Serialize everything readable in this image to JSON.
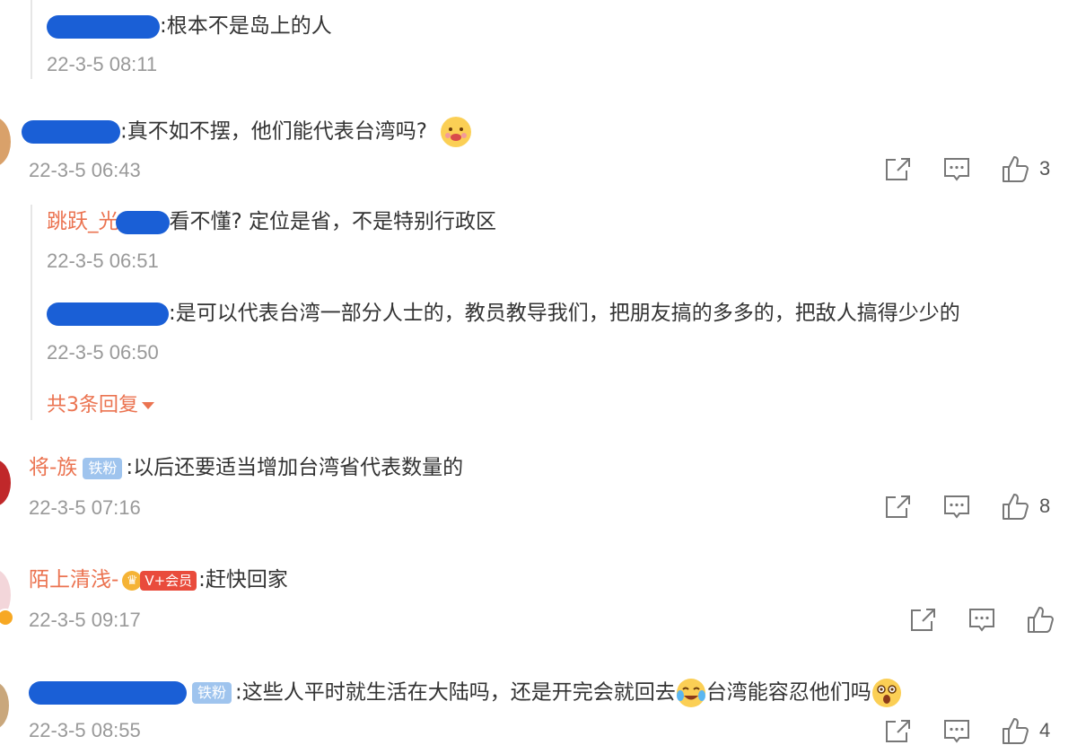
{
  "comments": [
    {
      "replies": [
        {
          "text": ":根本不是岛上的人",
          "time": "22-3-5 08:11"
        }
      ]
    },
    {
      "text": ":真不如不摆，他们能代表台湾吗?",
      "time": "22-3-5 06:43",
      "like_count": "3",
      "replies": [
        {
          "author_partial": "跳跃_光",
          "text": "看不懂? 定位是省，不是特别行政区",
          "time": "22-3-5 06:51"
        },
        {
          "text": ":是可以代表台湾一部分人士的，教员教导我们，把朋友搞的多多的，把敌人搞得少少的",
          "time": "22-3-5 06:50"
        }
      ],
      "more_replies": "共3条回复"
    },
    {
      "author": "将-族",
      "badge": "铁粉",
      "text": ":以后还要适当增加台湾省代表数量的",
      "time": "22-3-5 07:16",
      "like_count": "8"
    },
    {
      "author": "陌上清浅-",
      "vip_badge": "V+会员",
      "text": ":赶快回家",
      "time": "22-3-5 09:17"
    },
    {
      "badge": "铁粉",
      "text_a": ":这些人平时就生活在大陆吗，还是开完会就回去",
      "text_b": "台湾能容忍他们吗",
      "time": "22-3-5 08:55",
      "like_count": "4"
    }
  ],
  "icons": {
    "share": "share-icon",
    "comment": "comment-icon",
    "like": "thumb-up-icon",
    "emoji_drool": "drooling-face-emoji",
    "emoji_cry": "crying-laugh-emoji",
    "emoji_shock": "shocked-face-emoji"
  },
  "colors": {
    "author": "#eb7350",
    "meta": "#999999",
    "fan_badge": "#9fc4ee",
    "redaction": "#1a5fd6"
  }
}
